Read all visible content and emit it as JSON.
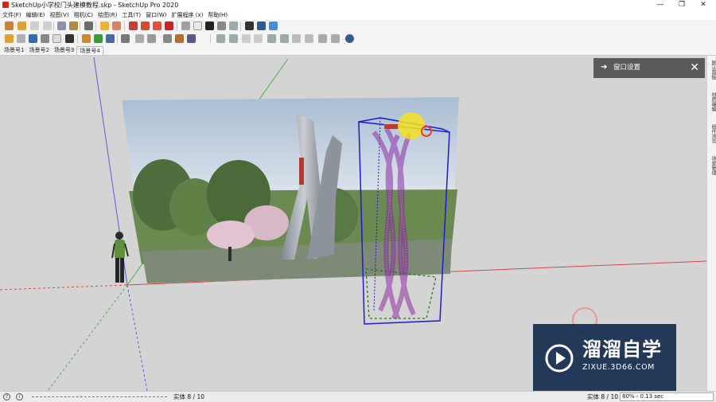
{
  "window": {
    "title": "SketchUp小学校门头建模教程.skp - SketchUp Pro 2020",
    "minimize_glyph": "—",
    "restore_glyph": "❐",
    "close_glyph": "✕"
  },
  "menu": [
    "文件(F)",
    "编辑(E)",
    "视图(V)",
    "相机(C)",
    "绘图(R)",
    "工具(T)",
    "窗口(W)",
    "扩展程序 (x)",
    "帮助(H)"
  ],
  "scenes": [
    "场景号1",
    "场景号2",
    "场景号3",
    "场景号4"
  ],
  "active_scene": 3,
  "tray": {
    "title": "窗口设置",
    "arrow_icon": "arrow-right-icon",
    "close_icon": "close-icon",
    "arrow_glyph": "➔",
    "close_glyph": "✕"
  },
  "side_tabs": [
    "默认面板",
    "材质编辑",
    "组件浏览",
    "场景管理"
  ],
  "watermark": {
    "brand_cn": "溜溜自学",
    "url": "ZIXUE.3D66.COM"
  },
  "status": {
    "help_icon": "question-icon",
    "info_icon": "info-icon",
    "help_glyph": "?",
    "info_glyph": "i",
    "entity_left": "实体 8 / 10",
    "entity_right": "实体 8 / 10",
    "measure": "80% - 0.13 sec"
  },
  "colors": {
    "viewport_bg": "#d4d4d4",
    "bbox_blue": "#1a1ad6",
    "model_magenta": "#8a2a9c",
    "tray_bg": "#5a5a5a",
    "watermark_bg": "#10284b"
  }
}
